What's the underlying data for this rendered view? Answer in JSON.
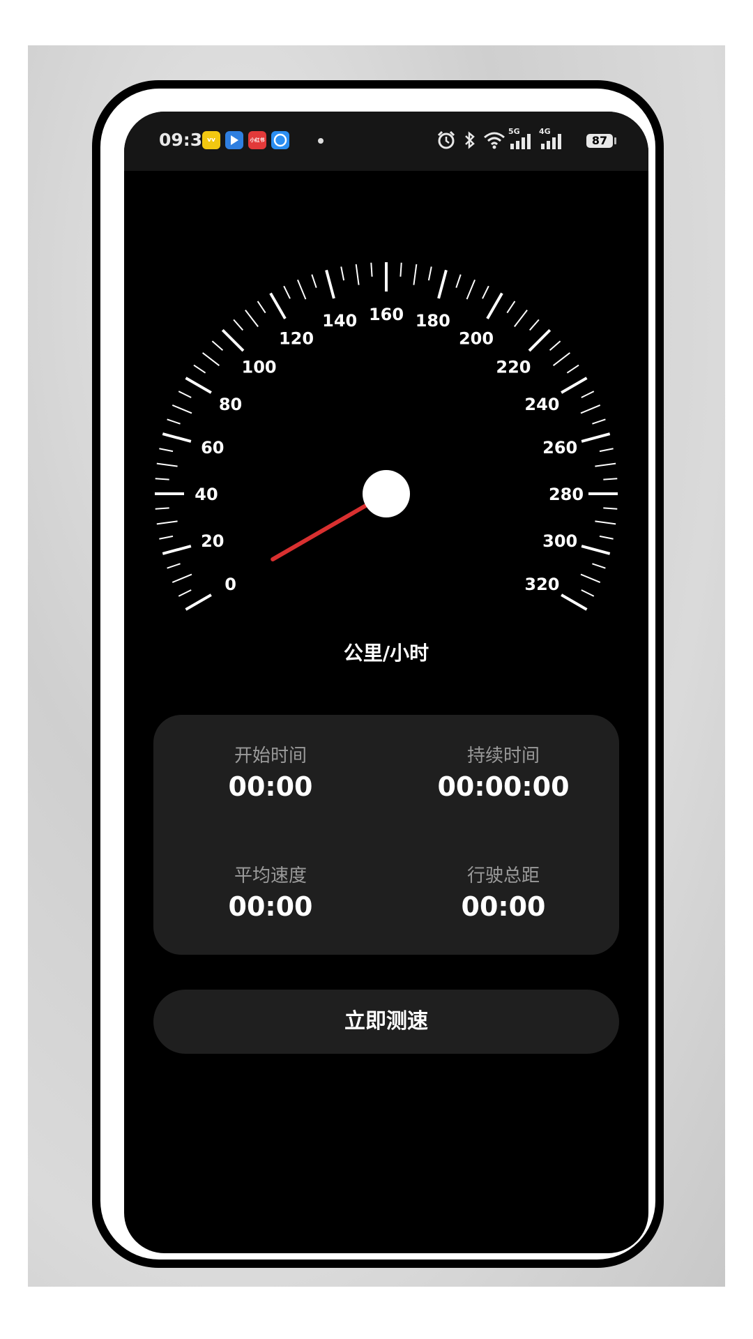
{
  "status_bar": {
    "time": "09:36",
    "apps": [
      {
        "name": "vv-app",
        "label": "vv",
        "color": "#f2c811"
      },
      {
        "name": "location-app",
        "label": "",
        "color": "#2f7fe0"
      },
      {
        "name": "xiaohongshu-app",
        "label": "小红书",
        "color": "#e23a3a"
      },
      {
        "name": "browser-app",
        "label": "",
        "color": "#2b8ef0"
      }
    ],
    "network_5g": "5G",
    "network_4g": "4G",
    "battery": "87"
  },
  "speedometer": {
    "tick_labels": [
      "0",
      "20",
      "40",
      "60",
      "80",
      "100",
      "120",
      "140",
      "160",
      "180",
      "200",
      "220",
      "240",
      "260",
      "280",
      "300",
      "320"
    ],
    "min": 0,
    "max": 320,
    "current_speed": 0,
    "needle_color": "#d93030",
    "unit": "公里/小时"
  },
  "stats": {
    "start_time": {
      "label": "开始时间",
      "value": "00:00"
    },
    "duration": {
      "label": "持续时间",
      "value": "00:00:00"
    },
    "avg_speed": {
      "label": "平均速度",
      "value": "00:00"
    },
    "total_distance": {
      "label": "行驶总距",
      "value": "00:00"
    }
  },
  "actions": {
    "measure_label": "立即测速"
  }
}
